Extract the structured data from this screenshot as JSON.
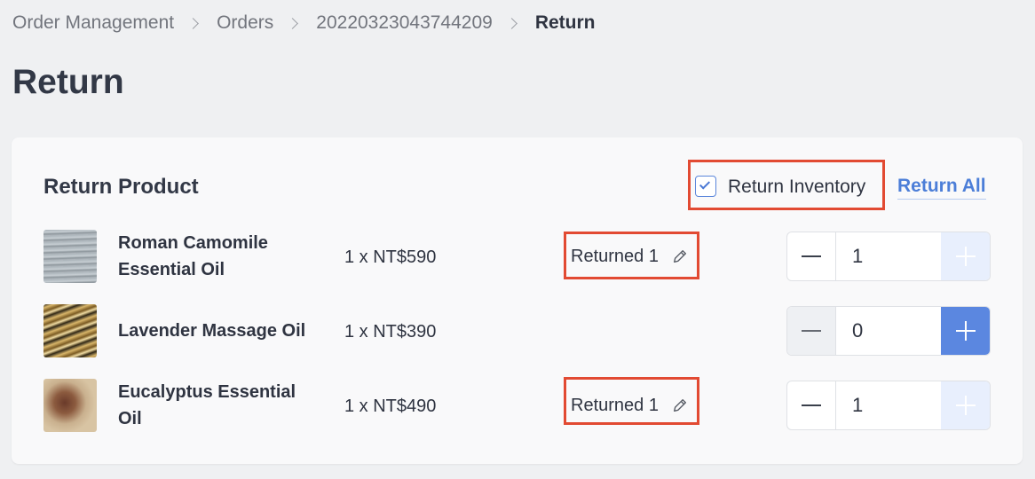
{
  "breadcrumb": {
    "items": [
      "Order Management",
      "Orders",
      "20220323043744209"
    ],
    "current": "Return"
  },
  "page_title": "Return",
  "card": {
    "title": "Return Product",
    "return_inventory_label": "Return Inventory",
    "return_inventory_checked": true,
    "return_all_label": "Return All"
  },
  "products": [
    {
      "name": "Roman Camomile Essential Oil",
      "quantity_price": "1 x NT$590",
      "returned_label": "Returned 1",
      "stepper_value": "1",
      "thumb_icon": "product-thumbnail"
    },
    {
      "name": "Lavender Massage Oil",
      "quantity_price": "1 x NT$390",
      "returned_label": "",
      "stepper_value": "0",
      "thumb_icon": "product-thumbnail"
    },
    {
      "name": "Eucalyptus Essential Oil",
      "quantity_price": "1 x NT$490",
      "returned_label": "Returned 1",
      "stepper_value": "1",
      "thumb_icon": "product-thumbnail"
    }
  ],
  "colors": {
    "accent": "#5b87e0",
    "highlight_border": "#e24a32",
    "link": "#4c7ed8"
  }
}
